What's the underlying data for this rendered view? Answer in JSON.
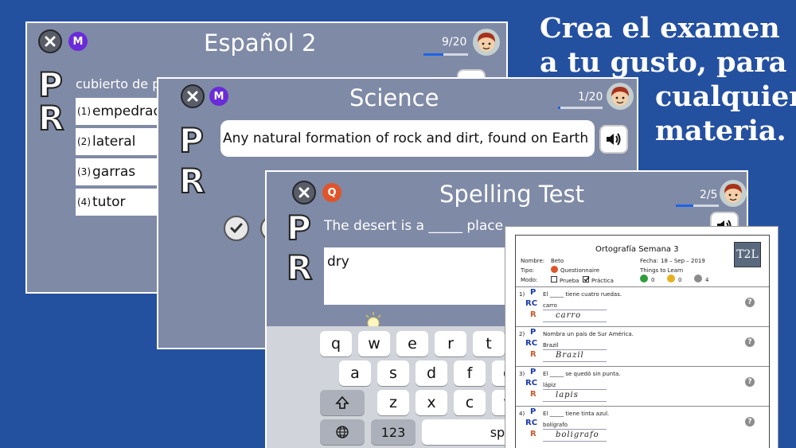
{
  "headline": [
    "Crea el examen",
    "a tu gusto, para",
    "cualquier",
    "materia."
  ],
  "cards": {
    "espanol": {
      "title": "Español 2",
      "mode": "M",
      "counter": "9/20",
      "progress": 0.45,
      "p_letter": "P",
      "r_letter": "R",
      "question": "cubierto de p",
      "options": [
        {
          "num": "(1)",
          "text": "empedrad"
        },
        {
          "num": "(2)",
          "text": "lateral"
        },
        {
          "num": "(3)",
          "text": "garras"
        },
        {
          "num": "(4)",
          "text": "tutor"
        }
      ]
    },
    "science": {
      "title": "Science",
      "mode": "M",
      "counter": "1/20",
      "progress": 0.05,
      "p_letter": "P",
      "r_letter": "R",
      "question": "Any natural formation of rock and dirt, found on Earth"
    },
    "spelling": {
      "title": "Spelling Test",
      "mode": "Q",
      "counter": "2/5",
      "progress": 0.4,
      "p_letter": "P",
      "r_letter": "R",
      "question": "The desert is a _____ place.",
      "answer": "dry"
    }
  },
  "keyboard": {
    "row1": [
      "q",
      "w",
      "e",
      "r",
      "t"
    ],
    "row2": [
      "a",
      "s",
      "d",
      "f",
      "g"
    ],
    "row3": [
      "z",
      "x",
      "c",
      "v"
    ],
    "num_key": "123",
    "space_key": "spa"
  },
  "sheet": {
    "title": "Ortografía Semana 3",
    "logo": "T2L",
    "nombre_label": "Nombre:",
    "nombre_value": "Beto",
    "fecha_label": "Fecha:",
    "fecha_value": "18 – Sep – 2019",
    "tipo_label": "Tipo:",
    "tipo_value": "Questionnaire",
    "modo_label": "Modo:",
    "modo_prueba": "Prueba",
    "modo_practica": "Práctica",
    "things_label": "Things to Learn",
    "count_correct": "0",
    "count_partial": "0",
    "count_unknown": "4",
    "label_P": "P",
    "label_RC": "RC",
    "label_R": "R",
    "items": [
      {
        "num": "1)",
        "question": "El _____ tiene cuatro ruedas.",
        "correct": "carro",
        "handwritten": "carro"
      },
      {
        "num": "2)",
        "question": "Nombra un país de Sur América.",
        "correct": "Brazil",
        "handwritten": "Brazil"
      },
      {
        "num": "3)",
        "question": "El _____ se quedó sin punta.",
        "correct": "lápiz",
        "handwritten": "lapis"
      },
      {
        "num": "4)",
        "question": "El _____ tiene tinta azul.",
        "correct": "bolígrafo",
        "handwritten": "boligrafo"
      }
    ]
  },
  "colors": {
    "background": "#2450a0",
    "card": "#7f8aa6",
    "badge_m": "#6a2bd8",
    "badge_q": "#e0542a",
    "progress": "#1e64e6"
  }
}
